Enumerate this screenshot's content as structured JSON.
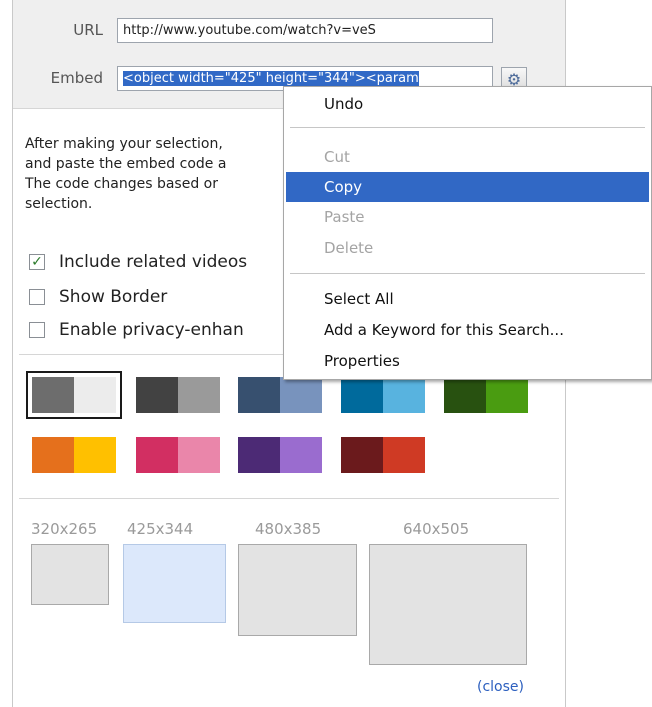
{
  "embed_panel": {
    "url_label": "URL",
    "url_value": "http://www.youtube.com/watch?v=veS",
    "embed_label": "Embed",
    "embed_value": "<object width=\"425\" height=\"344\"><param",
    "description": [
      "After making your selection,",
      "and paste the embed code a",
      "The code changes based or",
      "selection."
    ],
    "options": [
      {
        "label": "Include related videos",
        "checked": true
      },
      {
        "label": "Show Border",
        "checked": false
      },
      {
        "label": "Enable privacy-enhan",
        "checked": false
      }
    ],
    "swatches": [
      {
        "left": "#6d6d6d",
        "right": "#ececec",
        "selected": true
      },
      {
        "left": "#424242",
        "right": "#9a9a9a",
        "selected": false
      },
      {
        "left": "#37506f",
        "right": "#7893bd",
        "selected": false
      },
      {
        "left": "#006a9c",
        "right": "#58b3df",
        "selected": false
      },
      {
        "left": "#285110",
        "right": "#4a9c11",
        "selected": false
      },
      {
        "left": "#e5701c",
        "right": "#ffc000",
        "selected": false
      },
      {
        "left": "#d22f62",
        "right": "#ea86aa",
        "selected": false
      },
      {
        "left": "#4c2a75",
        "right": "#9a6ccf",
        "selected": false
      },
      {
        "left": "#6b1a1c",
        "right": "#cf3a24",
        "selected": false
      }
    ],
    "sizes": [
      "320x265",
      "425x344",
      "480x385",
      "640x505"
    ],
    "selected_size": "425x344",
    "close_label": "(close)"
  },
  "context_menu": {
    "items": [
      {
        "label": "Undo",
        "state": "normal"
      },
      {
        "label": "Cut",
        "state": "disabled"
      },
      {
        "label": "Copy",
        "state": "active"
      },
      {
        "label": "Paste",
        "state": "disabled"
      },
      {
        "label": "Delete",
        "state": "disabled"
      },
      {
        "label": "Select All",
        "state": "normal"
      },
      {
        "label": "Add a Keyword for this Search...",
        "state": "normal"
      },
      {
        "label": "Properties",
        "state": "normal"
      }
    ]
  },
  "icons": {
    "settings": "gear-icon",
    "checkbox_checked": "check-icon"
  }
}
